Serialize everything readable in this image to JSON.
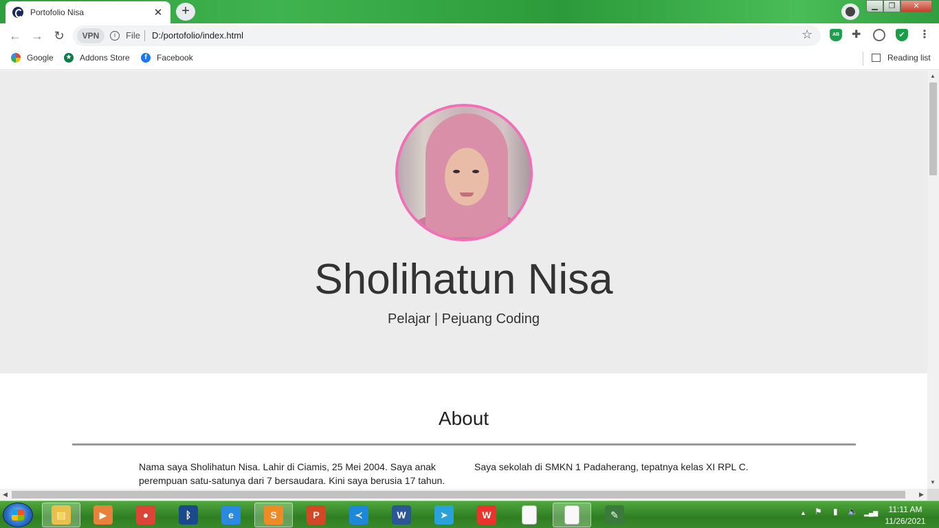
{
  "browser": {
    "tab_title": "Portofolio Nisa",
    "tab_close": "✕",
    "new_tab": "+",
    "window_min": "▁",
    "window_max": "❐",
    "window_close": "✕",
    "back": "←",
    "forward": "→",
    "reload": "↻",
    "vpn_label": "VPN",
    "info_glyph": "i",
    "file_label": "File",
    "url": "D:/portofolio/index.html",
    "bookmark_star": "☆",
    "ext_ab_label": "AB",
    "ext_puzzle": "✚",
    "ext_shield": "✔",
    "menu": "⋮",
    "bookmarks": [
      {
        "label": "Google",
        "icon": "google-icon"
      },
      {
        "label": "Addons Store",
        "icon": "addons-store-icon"
      },
      {
        "label": "Facebook",
        "icon": "facebook-icon"
      }
    ],
    "reading_list": "Reading list"
  },
  "page": {
    "name": "Sholihatun Nisa",
    "tagline": "Pelajar | Pejuang Coding",
    "about": {
      "heading": "About",
      "left": "Nama saya Sholihatun Nisa. Lahir di Ciamis, 25 Mei 2004. Saya anak perempuan satu-satunya dari 7 bersaudara. Kini saya berusia 17 tahun.",
      "right": "Saya sekolah di SMKN 1 Padaherang, tepatnya kelas XI RPL C."
    }
  },
  "scroll": {
    "up": "▲",
    "down": "▼",
    "left": "◀",
    "right": "▶"
  },
  "taskbar": {
    "apps": [
      {
        "name": "file-explorer",
        "glyph": "▤",
        "color": "#e8c04a"
      },
      {
        "name": "media-player",
        "glyph": "▶",
        "color": "#e8823a"
      },
      {
        "name": "chrome",
        "glyph": "●",
        "color": "#db4437"
      },
      {
        "name": "bluetooth",
        "glyph": "ᛒ",
        "color": "#1b4a8c"
      },
      {
        "name": "internet-explorer",
        "glyph": "e",
        "color": "#2a8ae0"
      },
      {
        "name": "sublime-text",
        "glyph": "S",
        "color": "#f08a24"
      },
      {
        "name": "powerpoint",
        "glyph": "P",
        "color": "#d24726"
      },
      {
        "name": "vscode",
        "glyph": "≺",
        "color": "#1e88d8"
      },
      {
        "name": "word",
        "glyph": "W",
        "color": "#2b5797"
      },
      {
        "name": "telegram",
        "glyph": "➤",
        "color": "#2aa1da"
      },
      {
        "name": "wps",
        "glyph": "W",
        "color": "#e8352b"
      },
      {
        "name": "blank-document",
        "glyph": "",
        "color": "#f8f8f8"
      },
      {
        "name": "notepad",
        "glyph": "",
        "color": "#f8f8f8"
      },
      {
        "name": "task-app",
        "glyph": "✎",
        "color": "#3a7a3a"
      }
    ],
    "tray_up": "▲",
    "tray_flag": "⚑",
    "tray_battery": "▮",
    "tray_volume": "🔈",
    "tray_signal": "▂▄▆",
    "time": "11:11 AM",
    "date": "11/26/2021"
  }
}
